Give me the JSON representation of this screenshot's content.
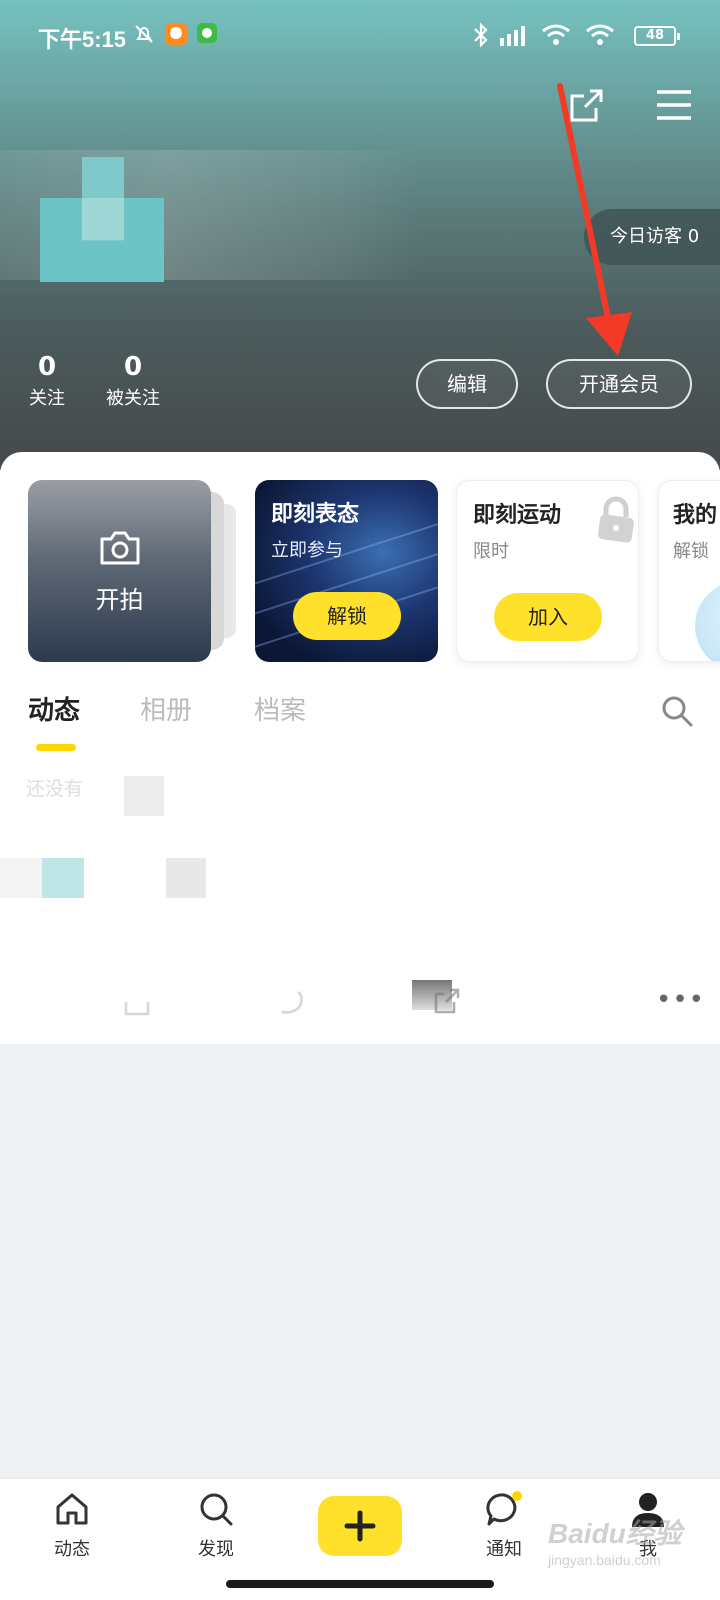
{
  "status_bar": {
    "time": "下午5:15",
    "battery": "48"
  },
  "header": {
    "visitor_label": "今日访客 0",
    "stats": [
      {
        "count": "0",
        "label": "关注"
      },
      {
        "count": "0",
        "label": "被关注"
      }
    ],
    "edit_label": "编辑",
    "vip_label": "开通会员"
  },
  "cards": {
    "shoot": {
      "label": "开拍"
    },
    "express": {
      "title": "即刻表态",
      "sub": "立即参与",
      "button": "解锁"
    },
    "sport": {
      "title": "即刻运动",
      "sub": "限时",
      "button": "加入"
    },
    "partial": {
      "title": "我的",
      "sub": "解锁"
    }
  },
  "tabs": {
    "items": [
      "动态",
      "相册",
      "档案"
    ],
    "active": "动态"
  },
  "feed": {
    "empty_text": "还没有"
  },
  "bottom_nav": {
    "items": [
      {
        "label": "动态",
        "icon": "home-icon"
      },
      {
        "label": "发现",
        "icon": "search-icon"
      },
      {
        "label": "",
        "icon": "plus-icon"
      },
      {
        "label": "通知",
        "icon": "chat-bubble-icon"
      },
      {
        "label": "我",
        "icon": "person-icon"
      }
    ]
  },
  "watermark": {
    "logo": "Baidu经验",
    "url": "jingyan.baidu.com"
  },
  "colors": {
    "accent": "#ffe12b",
    "underline": "#ffd600",
    "arrow": "#f23a26"
  }
}
